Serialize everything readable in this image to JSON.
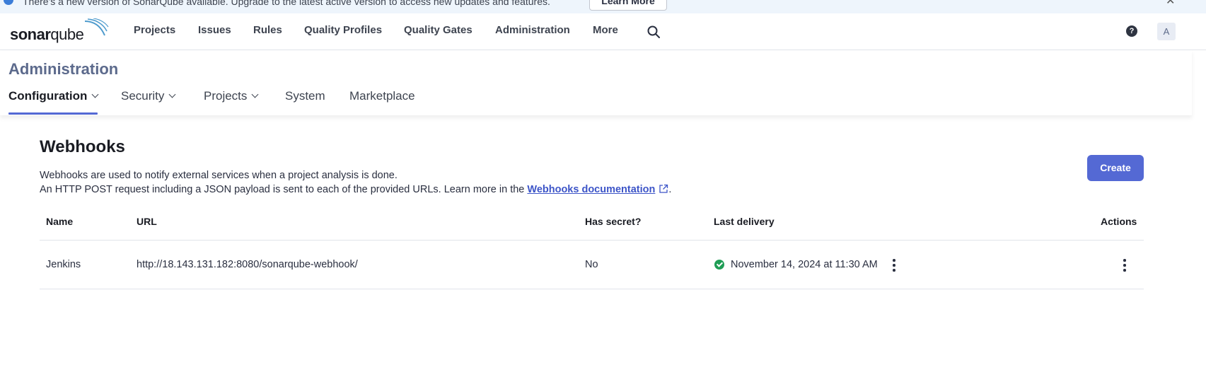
{
  "banner": {
    "text": "There's a new version of SonarQube available. Upgrade to the latest active version to access new updates and features.",
    "button_label": "Learn More"
  },
  "topnav": {
    "logo_bold": "sonar",
    "logo_light": "qube",
    "items": [
      "Projects",
      "Issues",
      "Rules",
      "Quality Profiles",
      "Quality Gates",
      "Administration",
      "More"
    ],
    "help_label": "?",
    "avatar_initial": "A"
  },
  "admin": {
    "title": "Administration",
    "tabs": [
      "Configuration",
      "Security",
      "Projects",
      "System",
      "Marketplace"
    ]
  },
  "webhooks": {
    "title": "Webhooks",
    "desc_line1": "Webhooks are used to notify external services when a project analysis is done.",
    "desc_line2_prefix": "An HTTP POST request including a JSON payload is sent to each of the provided URLs. Learn more in the",
    "doc_link": "Webhooks documentation",
    "desc_line2_suffix": ".",
    "create_label": "Create",
    "columns": {
      "name": "Name",
      "url": "URL",
      "has_secret": "Has secret?",
      "last_delivery": "Last delivery",
      "actions": "Actions"
    },
    "rows": [
      {
        "name": "Jenkins",
        "url": "http://18.143.131.182:8080/sonarqube-webhook/",
        "has_secret": "No",
        "last_delivery": "November 14, 2024 at 11:30 AM"
      }
    ]
  },
  "colors": {
    "accent": "#5469d4",
    "success": "#1f9d55",
    "admin_title": "#5c6a8c"
  }
}
